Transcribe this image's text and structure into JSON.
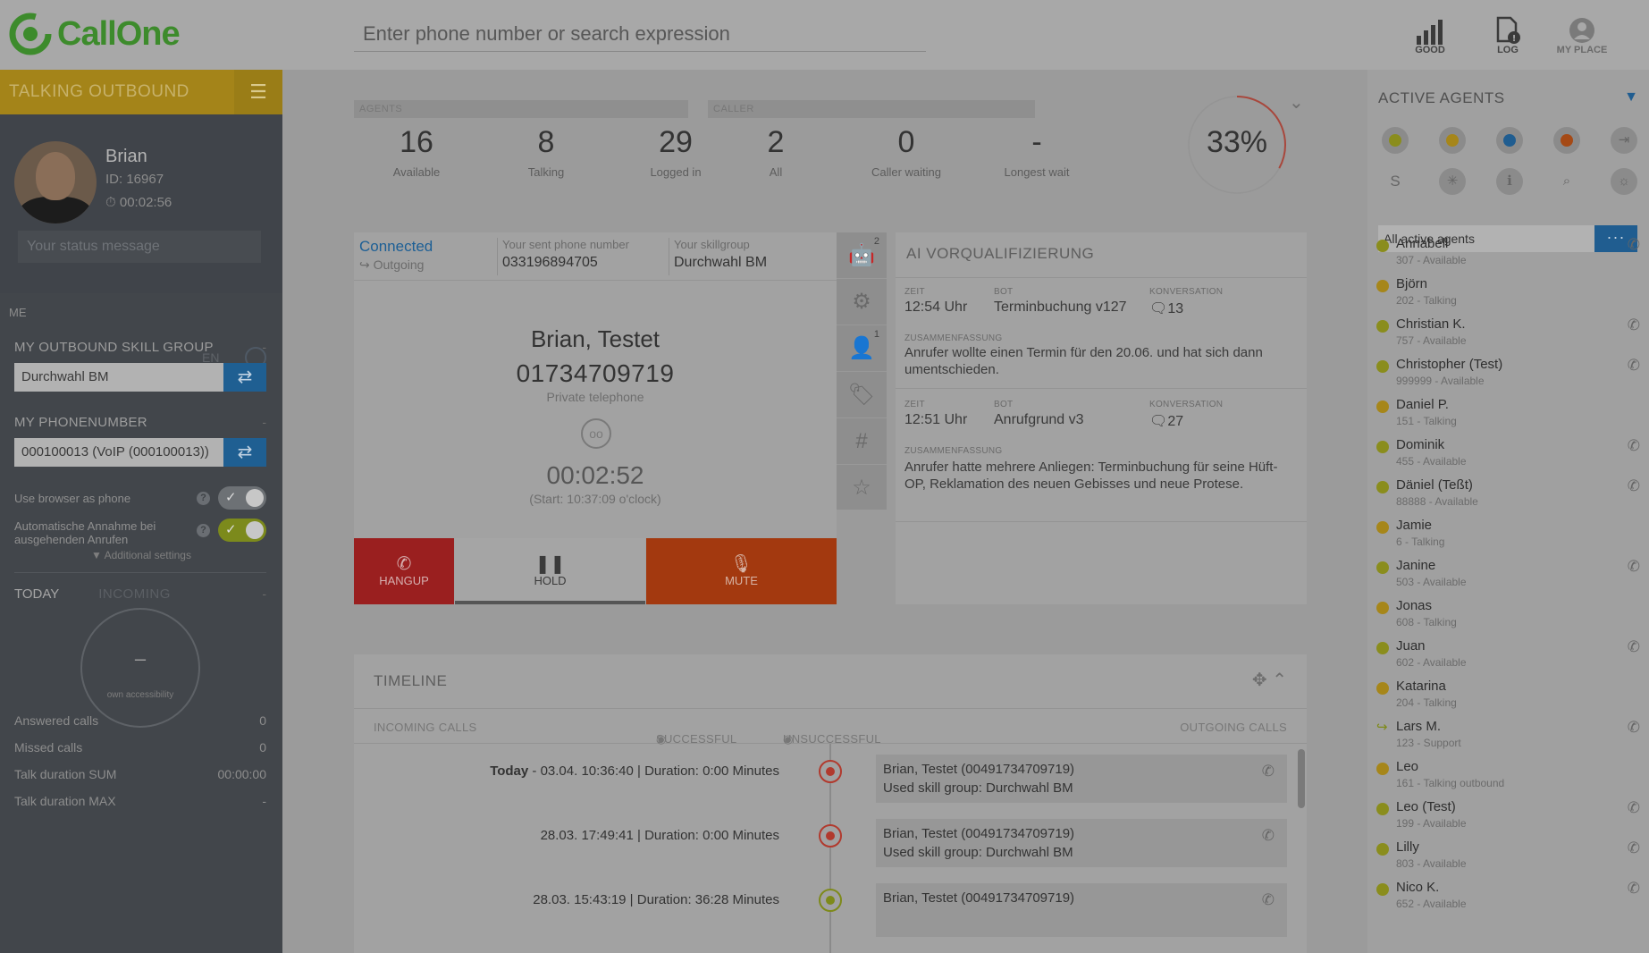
{
  "app": {
    "name": "CallOne",
    "search_placeholder": "Enter phone number or search expression",
    "top_icons": [
      {
        "label": "GOOD",
        "icon": "signal-bars-icon"
      },
      {
        "label": "LOG",
        "icon": "log-document-icon"
      },
      {
        "label": "MY PLACE",
        "icon": "user-circle-icon"
      }
    ]
  },
  "sidebar": {
    "status": "TALKING OUTBOUND",
    "menu_icon": "hamburger-icon",
    "user": {
      "name": "Brian",
      "id": "ID: 16967",
      "timer": "00:02:56"
    },
    "status_placeholder": "Your status message",
    "me_label": "ME",
    "lang": "EN",
    "skill_group": {
      "title": "MY OUTBOUND SKILL GROUP",
      "value": "Durchwahl BM",
      "dash": "-"
    },
    "phonenumber": {
      "title": "MY PHONENUMBER",
      "value": "000100013 (VoIP (000100013))",
      "dash": "-"
    },
    "options": [
      {
        "label": "Use browser as phone",
        "enabled": false
      },
      {
        "label": "Automatische Annahme bei ausgehenden Anrufen",
        "enabled": true
      }
    ],
    "additional_settings": "Additional settings",
    "today": {
      "tab_today": "TODAY",
      "tab_incoming": "INCOMING",
      "dash": "-",
      "gauge_value": "–",
      "gauge_label": "own accessibility",
      "stats": [
        {
          "label": "Answered calls",
          "value": "0"
        },
        {
          "label": "Missed calls",
          "value": "0"
        },
        {
          "label": "Talk duration SUM",
          "value": "00:00:00"
        },
        {
          "label": "Talk duration MAX",
          "value": "-"
        }
      ]
    }
  },
  "kpis": {
    "agents_title": "AGENTS",
    "caller_title": "CALLER",
    "agents": [
      {
        "value": "16",
        "label": "Available"
      },
      {
        "value": "8",
        "label": "Talking"
      },
      {
        "value": "29",
        "label": "Logged in"
      }
    ],
    "caller": [
      {
        "value": "2",
        "label": "All"
      },
      {
        "value": "0",
        "label": "Caller waiting"
      },
      {
        "value": "-",
        "label": "Longest wait"
      }
    ],
    "percent": "33%",
    "percent_fraction": 0.33
  },
  "call": {
    "state": "Connected",
    "direction": "Outgoing",
    "sent_number_label": "Your sent phone number",
    "sent_number": "033196894705",
    "skillgroup_label": "Your skillgroup",
    "skillgroup": "Durchwahl BM",
    "caller_name": "Brian, Testet",
    "caller_number": "01734709719",
    "caller_type": "Private telephone",
    "duration": "00:02:52",
    "start": "(Start: 10:37:09 o'clock)",
    "buttons": {
      "hangup": "HANGUP",
      "hold": "HOLD",
      "mute": "MUTE"
    },
    "tool_badges": {
      "bot": "2",
      "contact": "1"
    }
  },
  "ai": {
    "title": "AI VORQUALIFIZIERUNG",
    "labels": {
      "time": "ZEIT",
      "bot": "BOT",
      "conversation": "KONVERSATION",
      "summary": "ZUSAMMENFASSUNG"
    },
    "entries": [
      {
        "time": "12:54 Uhr",
        "bot": "Terminbuchung v127",
        "conversation": "13",
        "summary": "Anrufer wollte einen Termin für den 20.06. und hat sich dann umentschieden."
      },
      {
        "time": "12:51 Uhr",
        "bot": "Anrufgrund v3",
        "conversation": "27",
        "summary": "Anrufer hatte mehrere Anliegen: Terminbuchung für seine Hüft-OP, Reklamation des neuen Gebisses und neue Protese."
      }
    ]
  },
  "timeline": {
    "title": "TIMELINE",
    "headers": {
      "incoming": "INCOMING CALLS",
      "successful": "SUCCESSFUL",
      "unsuccessful": "UNSUCCESSFUL",
      "outgoing": "OUTGOING CALLS"
    },
    "rows": [
      {
        "prefix": "Today",
        "time": " - 03.04. 10:36:40 | Duration: 0:00 Minutes",
        "name": "Brian, Testet (00491734709719)",
        "group": "Used skill group: Durchwahl BM",
        "status": "unsuccessful"
      },
      {
        "prefix": "",
        "time": "28.03. 17:49:41 | Duration: 0:00 Minutes",
        "name": "Brian, Testet (00491734709719)",
        "group": "Used skill group: Durchwahl BM",
        "status": "unsuccessful"
      },
      {
        "prefix": "",
        "time": "28.03. 15:43:19 | Duration: 36:28 Minutes",
        "name": "Brian, Testet (00491734709719)",
        "group": "",
        "status": "successful"
      }
    ]
  },
  "agents_panel": {
    "title": "ACTIVE AGENTS",
    "select_value": "All active agents",
    "more_label": "···",
    "agents": [
      {
        "name": "Annabell",
        "status": "307 - Available",
        "color": "#8a8d1d",
        "phone": true
      },
      {
        "name": "Björn",
        "status": "202 - Talking",
        "color": "#a6861a",
        "phone": false
      },
      {
        "name": "Christian K.",
        "status": "757 - Available",
        "color": "#8a8d1d",
        "phone": true
      },
      {
        "name": "Christopher (Test)",
        "status": "999999 - Available",
        "color": "#8a8d1d",
        "phone": true
      },
      {
        "name": "Daniel P.",
        "status": "151 - Talking",
        "color": "#a6861a",
        "phone": false
      },
      {
        "name": "Dominik",
        "status": "455 - Available",
        "color": "#8a8d1d",
        "phone": true
      },
      {
        "name": "Däniel (Teßt)",
        "status": "88888 - Available",
        "color": "#8a8d1d",
        "phone": true
      },
      {
        "name": "Jamie",
        "status": "6 - Talking",
        "color": "#a6861a",
        "phone": false
      },
      {
        "name": "Janine",
        "status": "503 - Available",
        "color": "#8a8d1d",
        "phone": true
      },
      {
        "name": "Jonas",
        "status": "608 - Talking",
        "color": "#a6861a",
        "phone": false
      },
      {
        "name": "Juan",
        "status": "602 - Available",
        "color": "#8a8d1d",
        "phone": true
      },
      {
        "name": "Katarina",
        "status": "204 - Talking",
        "color": "#a6861a",
        "phone": false
      },
      {
        "name": "Lars M.",
        "status": "123 - Support",
        "color": "logout",
        "phone": true
      },
      {
        "name": "Leo",
        "status": "161 - Talking outbound",
        "color": "#a6861a",
        "phone": false
      },
      {
        "name": "Leo (Test)",
        "status": "199 - Available",
        "color": "#8a8d1d",
        "phone": true
      },
      {
        "name": "Lilly",
        "status": "803 - Available",
        "color": "#8a8d1d",
        "phone": true
      },
      {
        "name": "Nico K.",
        "status": "652 - Available",
        "color": "#8a8d1d",
        "phone": true
      }
    ]
  }
}
